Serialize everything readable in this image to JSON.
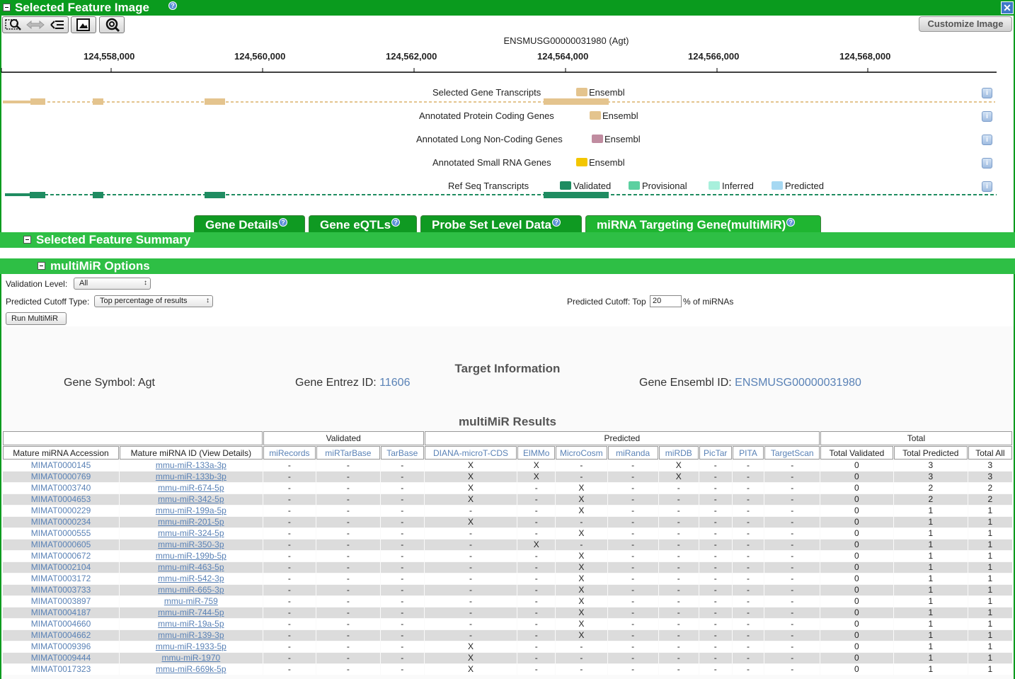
{
  "panel": {
    "title": "Selected Feature Image",
    "help_glyph": "?",
    "close_glyph": "✕"
  },
  "toolbar": {
    "customize_label": "Customize Image"
  },
  "image": {
    "gene_title": "ENSMUSG00000031980 (Agt)",
    "ruler": [
      "124,558,000",
      "124,560,000",
      "124,562,000",
      "124,564,000",
      "124,566,000",
      "124,568,000"
    ],
    "info_glyph": "i",
    "tracks": [
      {
        "label": "Selected Gene Transcripts",
        "legend": [
          {
            "text": "Ensembl",
            "color": "#e4c48e"
          }
        ]
      },
      {
        "label": "Annotated Protein Coding Genes",
        "legend": [
          {
            "text": "Ensembl",
            "color": "#e4c48e"
          }
        ]
      },
      {
        "label": "Annotated Long Non-Coding Genes",
        "legend": [
          {
            "text": "Ensembl",
            "color": "#c08ca0"
          }
        ]
      },
      {
        "label": "Annotated Small RNA Genes",
        "legend": [
          {
            "text": "Ensembl",
            "color": "#f3c600"
          }
        ]
      },
      {
        "label": "Ref Seq Transcripts",
        "legend": [
          {
            "text": "Validated",
            "color": "#1f8c61"
          },
          {
            "text": "Provisional",
            "color": "#5cd0a0"
          },
          {
            "text": "Inferred",
            "color": "#a8f0dc"
          },
          {
            "text": "Predicted",
            "color": "#a6d8f2"
          }
        ]
      }
    ]
  },
  "tabs": [
    {
      "label": "Gene Details",
      "active": false
    },
    {
      "label": "Gene eQTLs",
      "active": false
    },
    {
      "label": "Probe Set Level Data",
      "active": false
    },
    {
      "label": "miRNA Targeting Gene(multiMiR)",
      "active": true
    }
  ],
  "sections": {
    "summary": "Selected Feature Summary",
    "options": "multiMiR Options"
  },
  "options": {
    "validation_label": "Validation Level:",
    "validation_value": "All",
    "cutoff_type_label": "Predicted Cutoff Type:",
    "cutoff_type_value": "Top percentage of results",
    "cutoff_label": "Predicted Cutoff: Top",
    "cutoff_value": "20",
    "cutoff_suffix": "% of miRNAs",
    "run_label": "Run MultiMiR"
  },
  "target": {
    "title": "Target Information",
    "symbol_label": "Gene Symbol: Agt",
    "entrez_label": "Gene Entrez ID: ",
    "entrez_value": "11606",
    "ensembl_label": "Gene Ensembl ID: ",
    "ensembl_value": "ENSMUSG00000031980"
  },
  "results": {
    "title": "multiMiR Results",
    "groups": [
      "Validated",
      "Predicted",
      "Total"
    ],
    "columns": [
      "Mature miRNA Accession",
      "Mature miRNA ID (View Details)",
      "miRecords",
      "miRTarBase",
      "TarBase",
      "DIANA-microT-CDS",
      "ElMMo",
      "MicroCosm",
      "miRanda",
      "miRDB",
      "PicTar",
      "PITA",
      "TargetScan",
      "Total Validated",
      "Total Predicted",
      "Total All"
    ],
    "rows": [
      [
        "MIMAT0000145",
        "mmu-miR-133a-3p",
        "-",
        "-",
        "-",
        "X",
        "X",
        "-",
        "-",
        "X",
        "-",
        "-",
        "-",
        "0",
        "3",
        "3"
      ],
      [
        "MIMAT0000769",
        "mmu-miR-133b-3p",
        "-",
        "-",
        "-",
        "X",
        "X",
        "-",
        "-",
        "X",
        "-",
        "-",
        "-",
        "0",
        "3",
        "3"
      ],
      [
        "MIMAT0003740",
        "mmu-miR-674-5p",
        "-",
        "-",
        "-",
        "X",
        "-",
        "X",
        "-",
        "-",
        "-",
        "-",
        "-",
        "0",
        "2",
        "2"
      ],
      [
        "MIMAT0004653",
        "mmu-miR-342-5p",
        "-",
        "-",
        "-",
        "X",
        "-",
        "X",
        "-",
        "-",
        "-",
        "-",
        "-",
        "0",
        "2",
        "2"
      ],
      [
        "MIMAT0000229",
        "mmu-miR-199a-5p",
        "-",
        "-",
        "-",
        "-",
        "-",
        "X",
        "-",
        "-",
        "-",
        "-",
        "-",
        "0",
        "1",
        "1"
      ],
      [
        "MIMAT0000234",
        "mmu-miR-201-5p",
        "-",
        "-",
        "-",
        "X",
        "-",
        "-",
        "-",
        "-",
        "-",
        "-",
        "-",
        "0",
        "1",
        "1"
      ],
      [
        "MIMAT0000555",
        "mmu-miR-324-5p",
        "-",
        "-",
        "-",
        "-",
        "-",
        "X",
        "-",
        "-",
        "-",
        "-",
        "-",
        "0",
        "1",
        "1"
      ],
      [
        "MIMAT0000605",
        "mmu-miR-350-3p",
        "-",
        "-",
        "-",
        "-",
        "X",
        "-",
        "-",
        "-",
        "-",
        "-",
        "-",
        "0",
        "1",
        "1"
      ],
      [
        "MIMAT0000672",
        "mmu-miR-199b-5p",
        "-",
        "-",
        "-",
        "-",
        "-",
        "X",
        "-",
        "-",
        "-",
        "-",
        "-",
        "0",
        "1",
        "1"
      ],
      [
        "MIMAT0002104",
        "mmu-miR-463-5p",
        "-",
        "-",
        "-",
        "-",
        "-",
        "X",
        "-",
        "-",
        "-",
        "-",
        "-",
        "0",
        "1",
        "1"
      ],
      [
        "MIMAT0003172",
        "mmu-miR-542-3p",
        "-",
        "-",
        "-",
        "-",
        "-",
        "X",
        "-",
        "-",
        "-",
        "-",
        "-",
        "0",
        "1",
        "1"
      ],
      [
        "MIMAT0003733",
        "mmu-miR-665-3p",
        "-",
        "-",
        "-",
        "-",
        "-",
        "X",
        "-",
        "-",
        "-",
        "-",
        "-",
        "0",
        "1",
        "1"
      ],
      [
        "MIMAT0003897",
        "mmu-miR-759",
        "-",
        "-",
        "-",
        "-",
        "-",
        "X",
        "-",
        "-",
        "-",
        "-",
        "-",
        "0",
        "1",
        "1"
      ],
      [
        "MIMAT0004187",
        "mmu-miR-744-5p",
        "-",
        "-",
        "-",
        "-",
        "-",
        "X",
        "-",
        "-",
        "-",
        "-",
        "-",
        "0",
        "1",
        "1"
      ],
      [
        "MIMAT0004660",
        "mmu-miR-19a-5p",
        "-",
        "-",
        "-",
        "-",
        "-",
        "X",
        "-",
        "-",
        "-",
        "-",
        "-",
        "0",
        "1",
        "1"
      ],
      [
        "MIMAT0004662",
        "mmu-miR-139-3p",
        "-",
        "-",
        "-",
        "-",
        "-",
        "X",
        "-",
        "-",
        "-",
        "-",
        "-",
        "0",
        "1",
        "1"
      ],
      [
        "MIMAT0009396",
        "mmu-miR-1933-5p",
        "-",
        "-",
        "-",
        "X",
        "-",
        "-",
        "-",
        "-",
        "-",
        "-",
        "-",
        "0",
        "1",
        "1"
      ],
      [
        "MIMAT0009444",
        "mmu-miR-1970",
        "-",
        "-",
        "-",
        "X",
        "-",
        "-",
        "-",
        "-",
        "-",
        "-",
        "-",
        "0",
        "1",
        "1"
      ],
      [
        "MIMAT0017323",
        "mmu-miR-669k-5p",
        "-",
        "-",
        "-",
        "X",
        "-",
        "-",
        "-",
        "-",
        "-",
        "-",
        "-",
        "0",
        "1",
        "1"
      ]
    ]
  }
}
